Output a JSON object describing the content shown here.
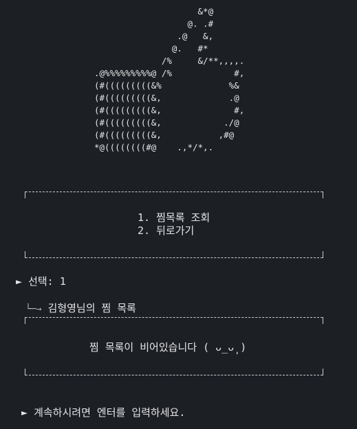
{
  "ascii_art": [
    "                    &*@",
    "                  @. .#",
    "                .@   &,",
    "               @.   #*",
    "             /%     &/**,,,,.",
    ".@%%%%%%%%%@ /%            #,",
    "(#(((((((((&%             %&",
    "(#(((((((((&,             .@",
    "(#(((((((((&,              #,",
    "(#(((((((((&,            ./@",
    "(#(((((((((&,           ,#@",
    "*@((((((((#@    .,*/*,."
  ],
  "menu": {
    "item1": "1. 찜목록 조회",
    "item2": "2. 뒤로가기"
  },
  "prompt": {
    "marker": "►",
    "label": "선택:",
    "value": "1"
  },
  "wishlist": {
    "arrow": "└─→",
    "title": "김형영님의 찜 목록",
    "empty_message": "찜 목록이 비어있습니다 ( ᴗ_ᴗ̩̩ )"
  },
  "continue": {
    "marker": "►",
    "text": "계속하시려면 엔터를 입력하세요."
  }
}
